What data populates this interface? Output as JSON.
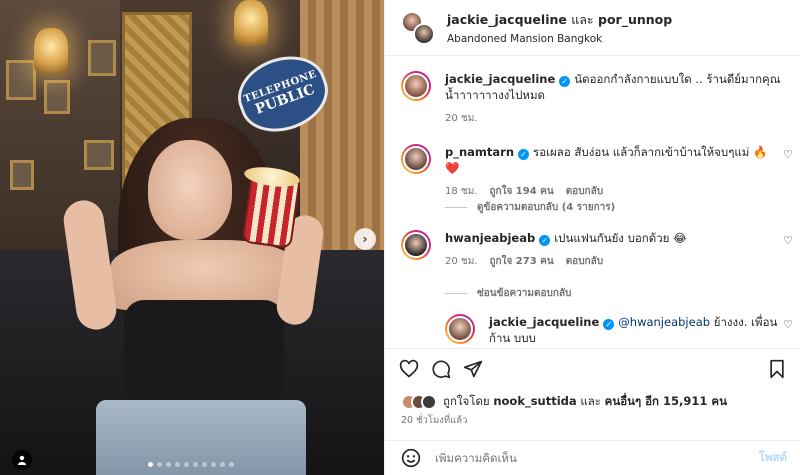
{
  "post": {
    "images_total": 10,
    "current_image": 1,
    "sign_line1": "TELEPHONE",
    "sign_line2": "PUBLIC"
  },
  "header": {
    "user1": "jackie_jacqueline",
    "connector": "และ",
    "user2": "por_unnop",
    "location": "Abandoned Mansion Bangkok"
  },
  "caption": {
    "username": "jackie_jacqueline",
    "text": "นัดออกกำลังกายแบบใด .. ร้านดีย์มากคุณ น้ำาาาาาางงไปหมด",
    "time": "20 ชม."
  },
  "comments": [
    {
      "username": "p_namtarn",
      "text": "รอเผลอ สับง่อน แล้วก็ลากเข้าบ้านให้จบๆแม่ 🔥❤️",
      "time": "18 ชม.",
      "likes": "ถูกใจ 194 คน",
      "reply": "ตอบกลับ",
      "view_replies": "ดูข้อความตอบกลับ (4 รายการ)"
    },
    {
      "username": "hwanjeabjeab",
      "text": "เปนแฟนกันยัง บอกด้วย 😂",
      "time": "20 ชม.",
      "likes": "ถูกใจ 273 คน",
      "reply": "ตอบกลับ",
      "hide_replies": "ซ่อนข้อความตอบกลับ"
    }
  ],
  "nested_reply": {
    "username": "jackie_jacqueline",
    "mention": "@hwanjeabjeab",
    "text": "ย้างงง. เพื่อนก้าน บบบ"
  },
  "likes_line": {
    "prefix": "ถูกใจโดย",
    "user": "nook_suttida",
    "middle": "และ",
    "others": "คนอื่นๆ อีก 15,911 คน"
  },
  "post_time": "20 ชั่วโมงที่แล้ว",
  "add_comment": {
    "placeholder": "เพิ่มความคิดเห็น",
    "post_label": "โพสต์"
  }
}
